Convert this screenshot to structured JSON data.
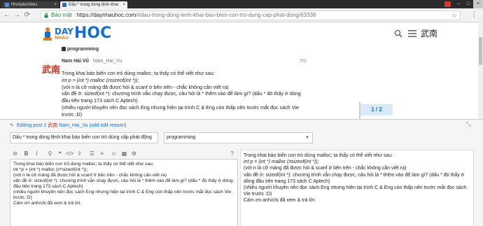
{
  "browser": {
    "tabs": [
      {
        "label": "HrsAptechites"
      },
      {
        "label": "Dấu * trong dòng lệnh khai"
      }
    ],
    "profile_label": "",
    "secure_label": "Bảo mật",
    "url_host": "https://daynhauhoc.com",
    "url_path": "/t/dau-trong-dong-lenh-khai-bao-bien-con-tro-dung-cap-phat-dong/63338"
  },
  "site": {
    "logo_day": "DAY",
    "logo_nhau": "NHAU",
    "logo_hoc": "HOC",
    "user_avatar_glyph": "武南"
  },
  "topic": {
    "category": "programming"
  },
  "post": {
    "author_name": "Nam Hải Vũ",
    "author_username": "Nam_Hai_Vu",
    "time": "7m",
    "avatar_glyph": "武南",
    "lines": [
      {
        "text": "Trong khai báo biến con trỏ dùng malloc; ta thấy có thể viết như sau:",
        "italic": false
      },
      {
        "text": "int p = (int *) malloc (nsizeof(int *));",
        "italic": true
      },
      {
        "text": "(với n là cỡ mảng đã được hỏi & scanf ở bên trên - chắc không cần viết ra)",
        "italic": false
      },
      {
        "text": "vấn đề ở: sizeof(int *): chương trình vẫn chạy được, câu hỏi là * thêm vào để làm gì? (dấu * đó thấy ở dòng",
        "italic": false
      },
      {
        "text": "đầu tiên trang 173 sách C Aptech)",
        "italic": false
      },
      {
        "text": "(nhiều người khuyên nên đọc sách Eng nhưng hiện tại trình C & Eng còn thấp nên trước mắt đọc sách Vie",
        "italic": false
      },
      {
        "text": "trước :D)",
        "italic": false
      }
    ]
  },
  "timeline": {
    "position": "1 / 2"
  },
  "composer": {
    "editing_label": "Editing post 1",
    "editing_user": "Nam_Hai_Vu",
    "editing_reason": "(add edit reason)",
    "avatar_glyph": "武南",
    "title_value": "Dấu * trong dòng lệnh khai báo biến con trỏ dùng cấp phát động",
    "category_value": "programming",
    "editor_text": "Trong khai báo biến con trỏ dùng malloc; ta thấy có thể viết như sau:\nint *p = (int *) malloc (n*sizeof(int *));\n(với n là cỡ mảng đã được hỏi & scanf ở bên trên - chắc không cần viết ra)\nvấn đề ở: sizeof(int *): chương trình vẫn chạy được, câu hỏi là * thêm vào để làm gì? (dấu * đó thấy ở dòng đầu tiên trang 173 sách C Aptech)\n(nhiều người khuyên nên đọc sách Eng nhưng hiện tại trình C & Eng còn thấp nên trước mắt đọc sách Vie trước :D)\nCảm ơn anh/chị đã xem & trả lời.",
    "preview_lines": [
      {
        "text": "Trong khai báo biến con trỏ dùng malloc; ta thấy có thể viết như sau:",
        "italic": false
      },
      {
        "text": "int p = (int *) malloc (nsizeof(int *));",
        "italic": true
      },
      {
        "text": "(với n là cỡ mảng đã được hỏi & scanf ở bên trên - chắc không cần viết ra)",
        "italic": false
      },
      {
        "text": "vấn đề ở: sizeof(int *): chương trình vẫn chạy được, câu hỏi là * thêm vào để làm gì? (dấu * đó thấy ở dòng đầu tiên trang 173 sách C Aptech)",
        "italic": false
      },
      {
        "text": "(nhiều người khuyên nên đọc sách Eng nhưng hiện tại trình C & Eng còn thấp nên trước mắt đọc sách Vie trước :D)",
        "italic": false
      },
      {
        "text": "Cảm ơn anh/chị đã xem & trả lời.",
        "italic": false
      }
    ],
    "toolbar_icons": [
      "bold-icon",
      "italic-icon",
      "link-icon",
      "quote-icon",
      "code-icon",
      "image-icon",
      "upload-icon",
      "bullet-list-icon",
      "numbered-list-icon",
      "emoji-icon",
      "date-icon",
      "settings-icon"
    ]
  }
}
